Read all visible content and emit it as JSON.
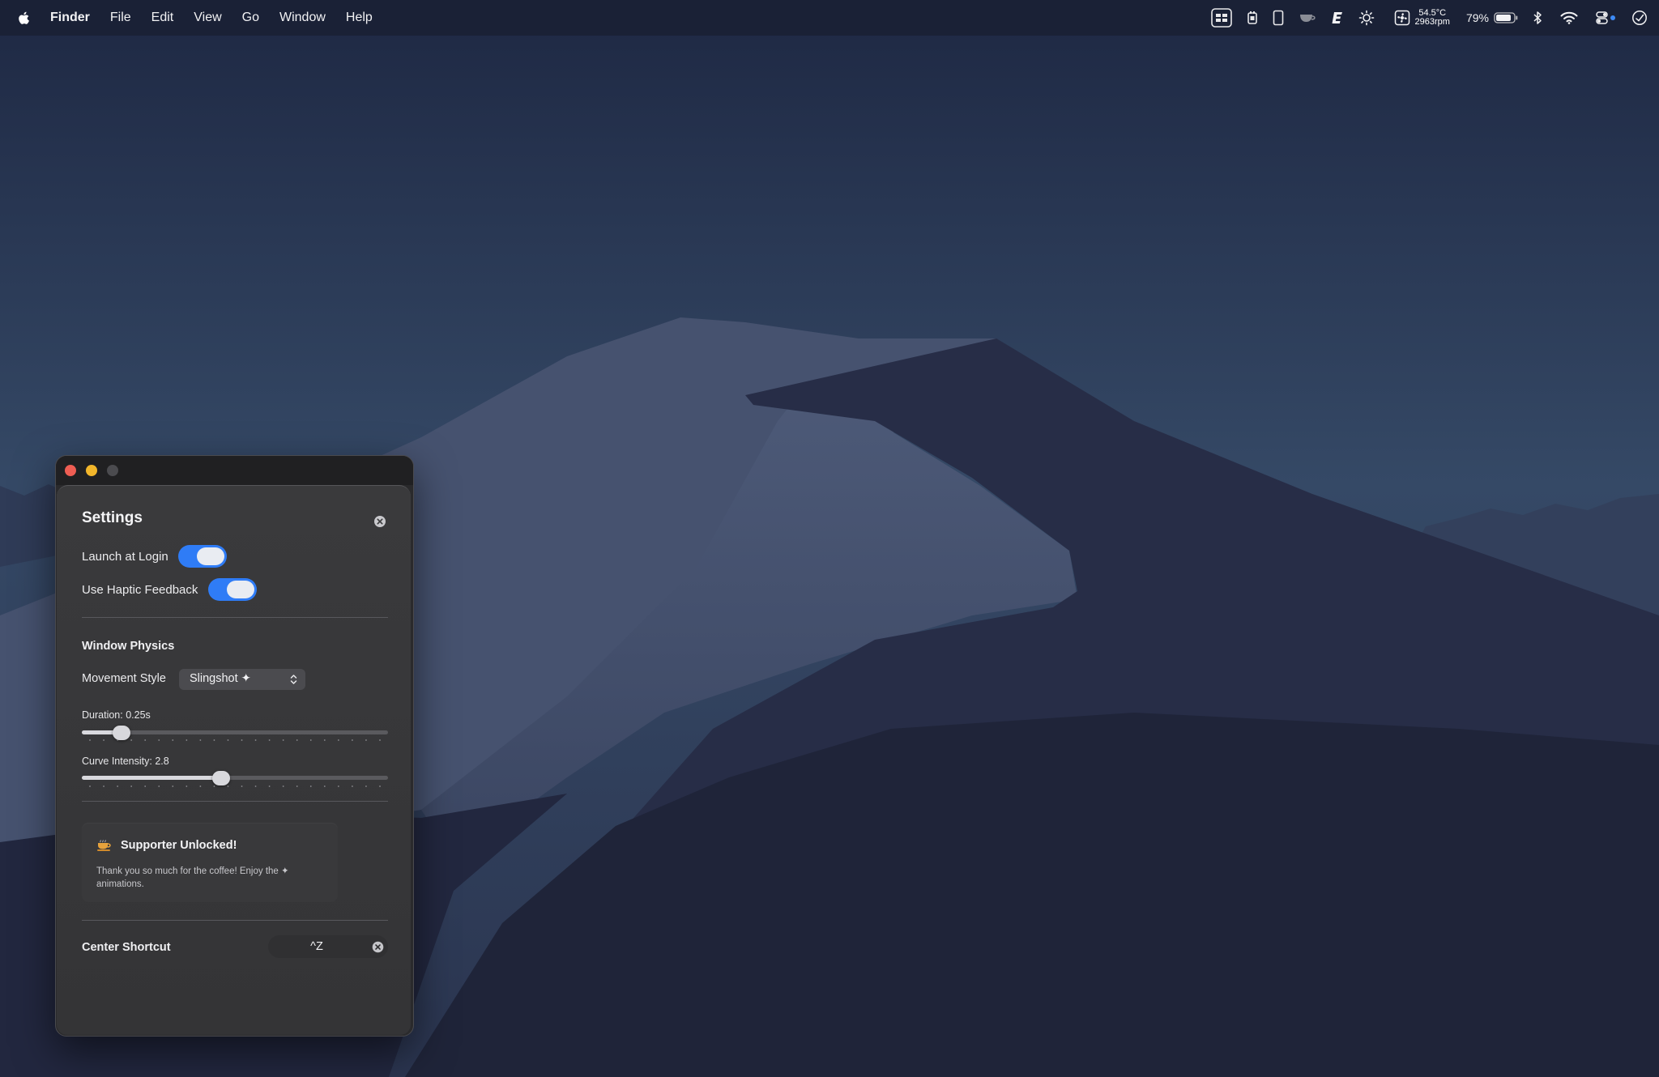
{
  "menubar": {
    "app_name": "Finder",
    "menus": [
      "File",
      "Edit",
      "View",
      "Go",
      "Window",
      "Help"
    ],
    "status": {
      "temperature": "54.5°C",
      "fan_speed": "2963rpm",
      "battery_percent": "79%",
      "icons": [
        "window-layout-icon",
        "cpu-chip-icon",
        "tablet-icon",
        "coffee-cup-icon",
        "text-e-icon",
        "brightness-icon",
        "fan-icon",
        "battery-icon",
        "bluetooth-icon",
        "wifi-icon",
        "control-center-icon",
        "clock-check-icon"
      ]
    }
  },
  "settings": {
    "title": "Settings",
    "launch_at_login": {
      "label": "Launch at Login",
      "enabled": true
    },
    "haptic_feedback": {
      "label": "Use Haptic Feedback",
      "enabled": true
    },
    "window_physics": {
      "title": "Window Physics",
      "movement_style_label": "Movement Style",
      "movement_style_value": "Slingshot ✦",
      "duration": {
        "label": "Duration: 0.25s",
        "fraction": 0.13
      },
      "curve_intensity": {
        "label": "Curve Intensity: 2.8",
        "fraction": 0.455
      }
    },
    "supporter": {
      "title": "Supporter Unlocked!",
      "text": "Thank you so much for the coffee! Enjoy the ✦ animations."
    },
    "center_shortcut": {
      "label": "Center Shortcut",
      "value": "^Z"
    }
  },
  "colors": {
    "accent": "#2f7cf6",
    "traffic_close": "#ee5d53",
    "traffic_minimize": "#f2b62b",
    "traffic_zoom": "#4b4b4f"
  }
}
